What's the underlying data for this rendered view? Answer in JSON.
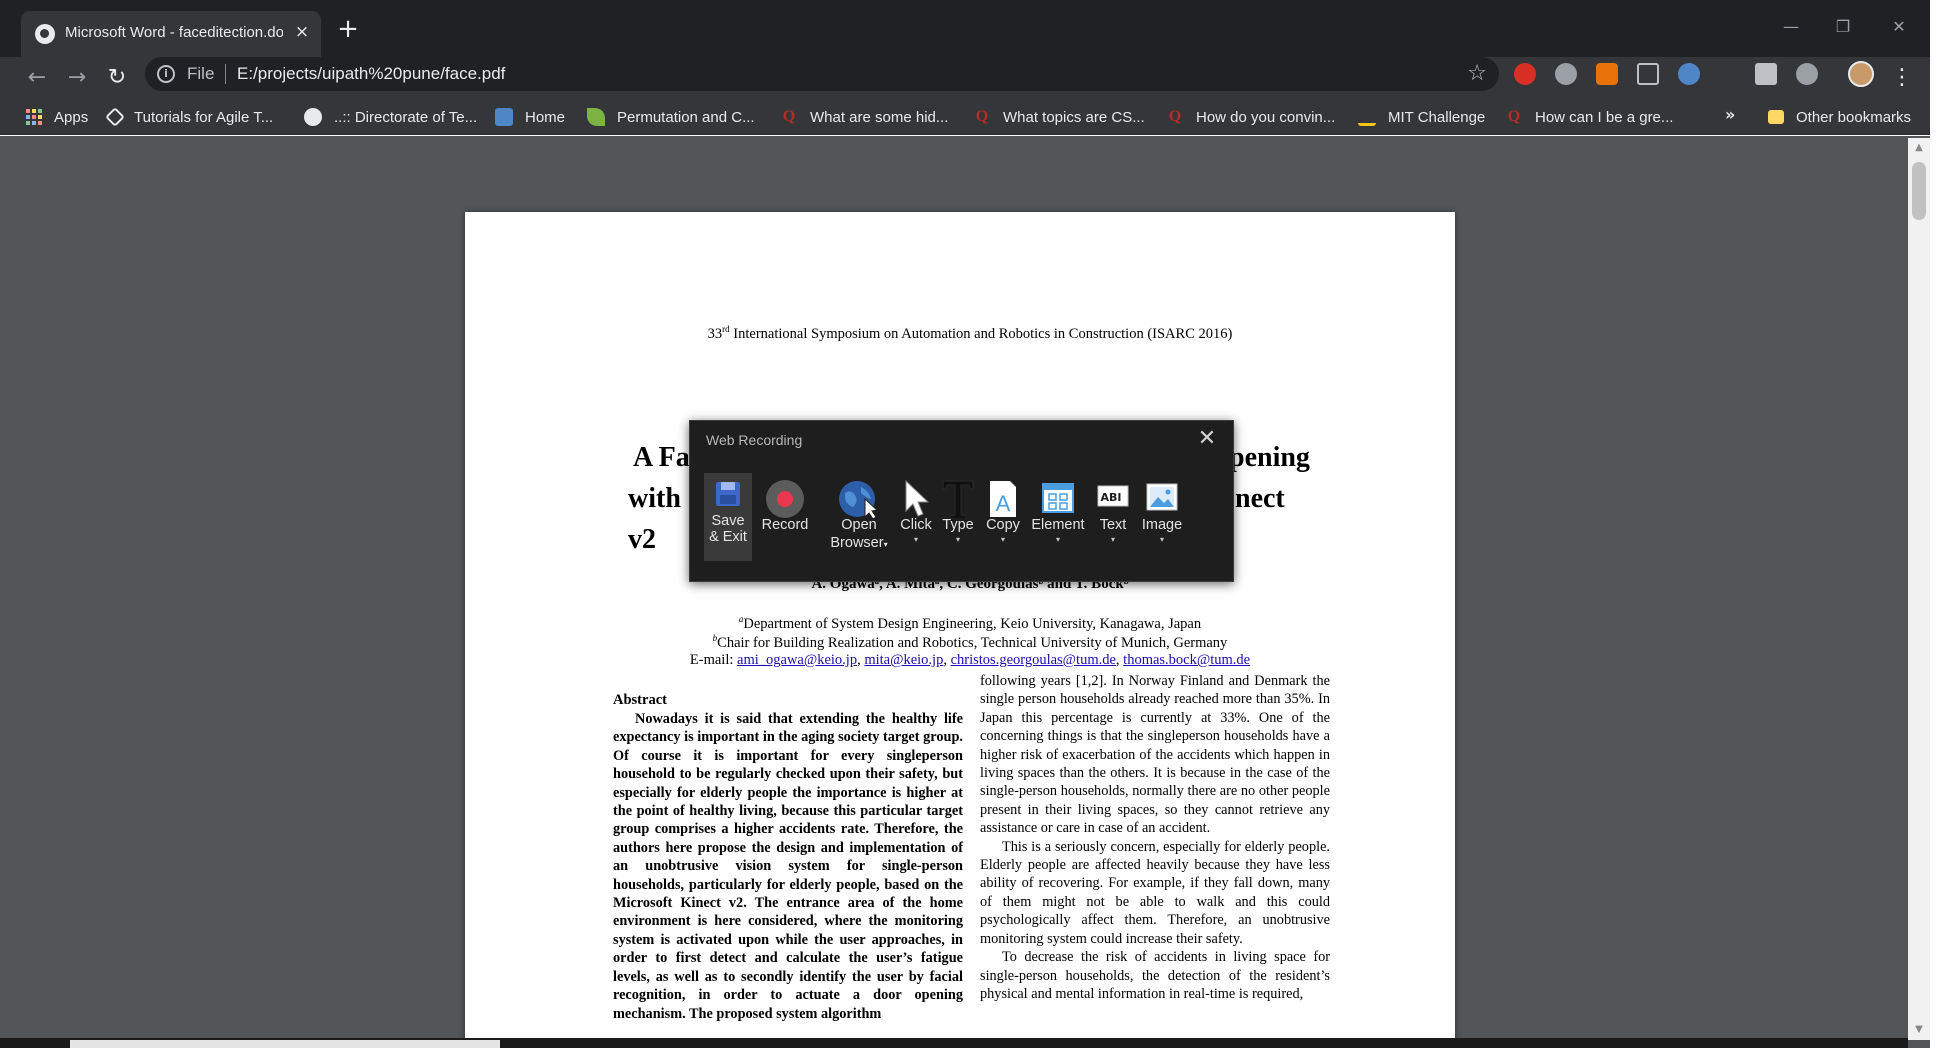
{
  "browser": {
    "tab_title": "Microsoft Word - faceditection.docx",
    "tab_close": "×",
    "new_tab": "+",
    "url_scheme": "File",
    "url_path": "E:/projects/uipath%20pune/face.pdf",
    "window_controls": [
      "—",
      "❐",
      "✕"
    ],
    "nav": {
      "back": "←",
      "forward": "→",
      "reload": "↻"
    },
    "star": "☆",
    "menu": "⋮"
  },
  "bookmarks": {
    "apps": "Apps",
    "items": [
      {
        "label": "Tutorials for Agile T...",
        "icon": "agile-icon",
        "color": "#e8eaed"
      },
      {
        "label": "..:: Directorate of Te...",
        "icon": "globe-icon",
        "color": "#e8eaed"
      },
      {
        "label": "Home",
        "icon": "site-icon",
        "color": "#4f86c6"
      },
      {
        "label": "Permutation and C...",
        "icon": "leaf-icon",
        "color": "#7cb342"
      },
      {
        "label": "What are some hid...",
        "icon": "quora-icon",
        "color": "#b92b27"
      },
      {
        "label": "What topics are CS...",
        "icon": "quora-icon",
        "color": "#b92b27"
      },
      {
        "label": "How do you convin...",
        "icon": "quora-icon",
        "color": "#b92b27"
      },
      {
        "label": "MIT Challenge",
        "icon": "scotth-icon",
        "color": "#f5c518"
      },
      {
        "label": "How can I be a gre...",
        "icon": "quora-icon",
        "color": "#b92b27"
      }
    ],
    "overflow": "»",
    "other": "Other bookmarks"
  },
  "document": {
    "conference_number": "33",
    "conference_sup": "rd",
    "conference_rest": " International Symposium on Automation and Robotics in Construction (ISARC 2016)",
    "title_line1_left": "A Fa",
    "title_line1_right": "pening",
    "title_line2_left": "with",
    "title_line2_right": "nect",
    "title_line3_left": "v2",
    "authors": "A. Ogawaᵃ, A. Mitaᵃ, C. Georgoulasᵇ and T. Bockᵇ",
    "affil_a_sup": "a",
    "affil_a": "Department of System Design Engineering, Keio University, Kanagawa, Japan",
    "affil_b_sup": "b",
    "affil_b": "Chair for Building Realization and Robotics, Technical University of Munich, Germany",
    "email_label": "E-mail: ",
    "emails": [
      "ami_ogawa@keio.jp",
      "mita@keio.jp",
      "christos.georgoulas@tum.de",
      "thomas.bock@tum.de"
    ],
    "abstract_heading": "Abstract",
    "abstract_text": "Nowadays it is said that extending the healthy life expectancy is important in the aging society target group. Of course it is important for every singleperson household to be regularly checked upon their safety, but especially for elderly people the importance is higher at the point of healthy living, because this particular target group comprises a higher accidents rate. Therefore, the authors here propose the design and implementation of an unobtrusive vision system for single-person households, particularly for elderly people, based on the Microsoft Kinect v2. The entrance area of the home environment is here considered, where the monitoring system is activated upon while the user approaches, in order to first detect and calculate the user’s fatigue levels, as well as to secondly identify the user by facial recognition, in order to actuate a door opening mechanism. The proposed system algorithm",
    "right_p1": "following years [1,2]. In Norway Finland and Denmark the single person households already reached more than 35%. In Japan this percentage is currently at 33%. One of the concerning things is that the singleperson households have a higher risk of exacerbation of the accidents which happen in living spaces than the others. It is because in the case of the single-person households, normally there are no other people present in their living spaces, so they cannot retrieve any assistance or care in case of an accident.",
    "right_p2": "This is a seriously concern, especially for elderly people. Elderly people are affected heavily because they have less ability of recovering. For example, if they fall down, many of them might not be able to walk and this could psychologically affect them. Therefore, an unobtrusive monitoring system could increase their safety.",
    "right_p3": "To decrease the risk of accidents in living space for single-person households, the detection of the resident’s physical and mental information in real-time is required,"
  },
  "recorder": {
    "title": "Web Recording",
    "close": "✕",
    "buttons": {
      "save_line1": "Save",
      "save_line2": "& Exit",
      "record": "Record",
      "open_line1": "Open",
      "open_line2": "Browser",
      "click": "Click",
      "type": "Type",
      "copy": "Copy",
      "element": "Element",
      "text": "Text",
      "image": "Image"
    },
    "caret": "▾",
    "record_color": "#e8384f",
    "accent": "#4a9de0"
  }
}
